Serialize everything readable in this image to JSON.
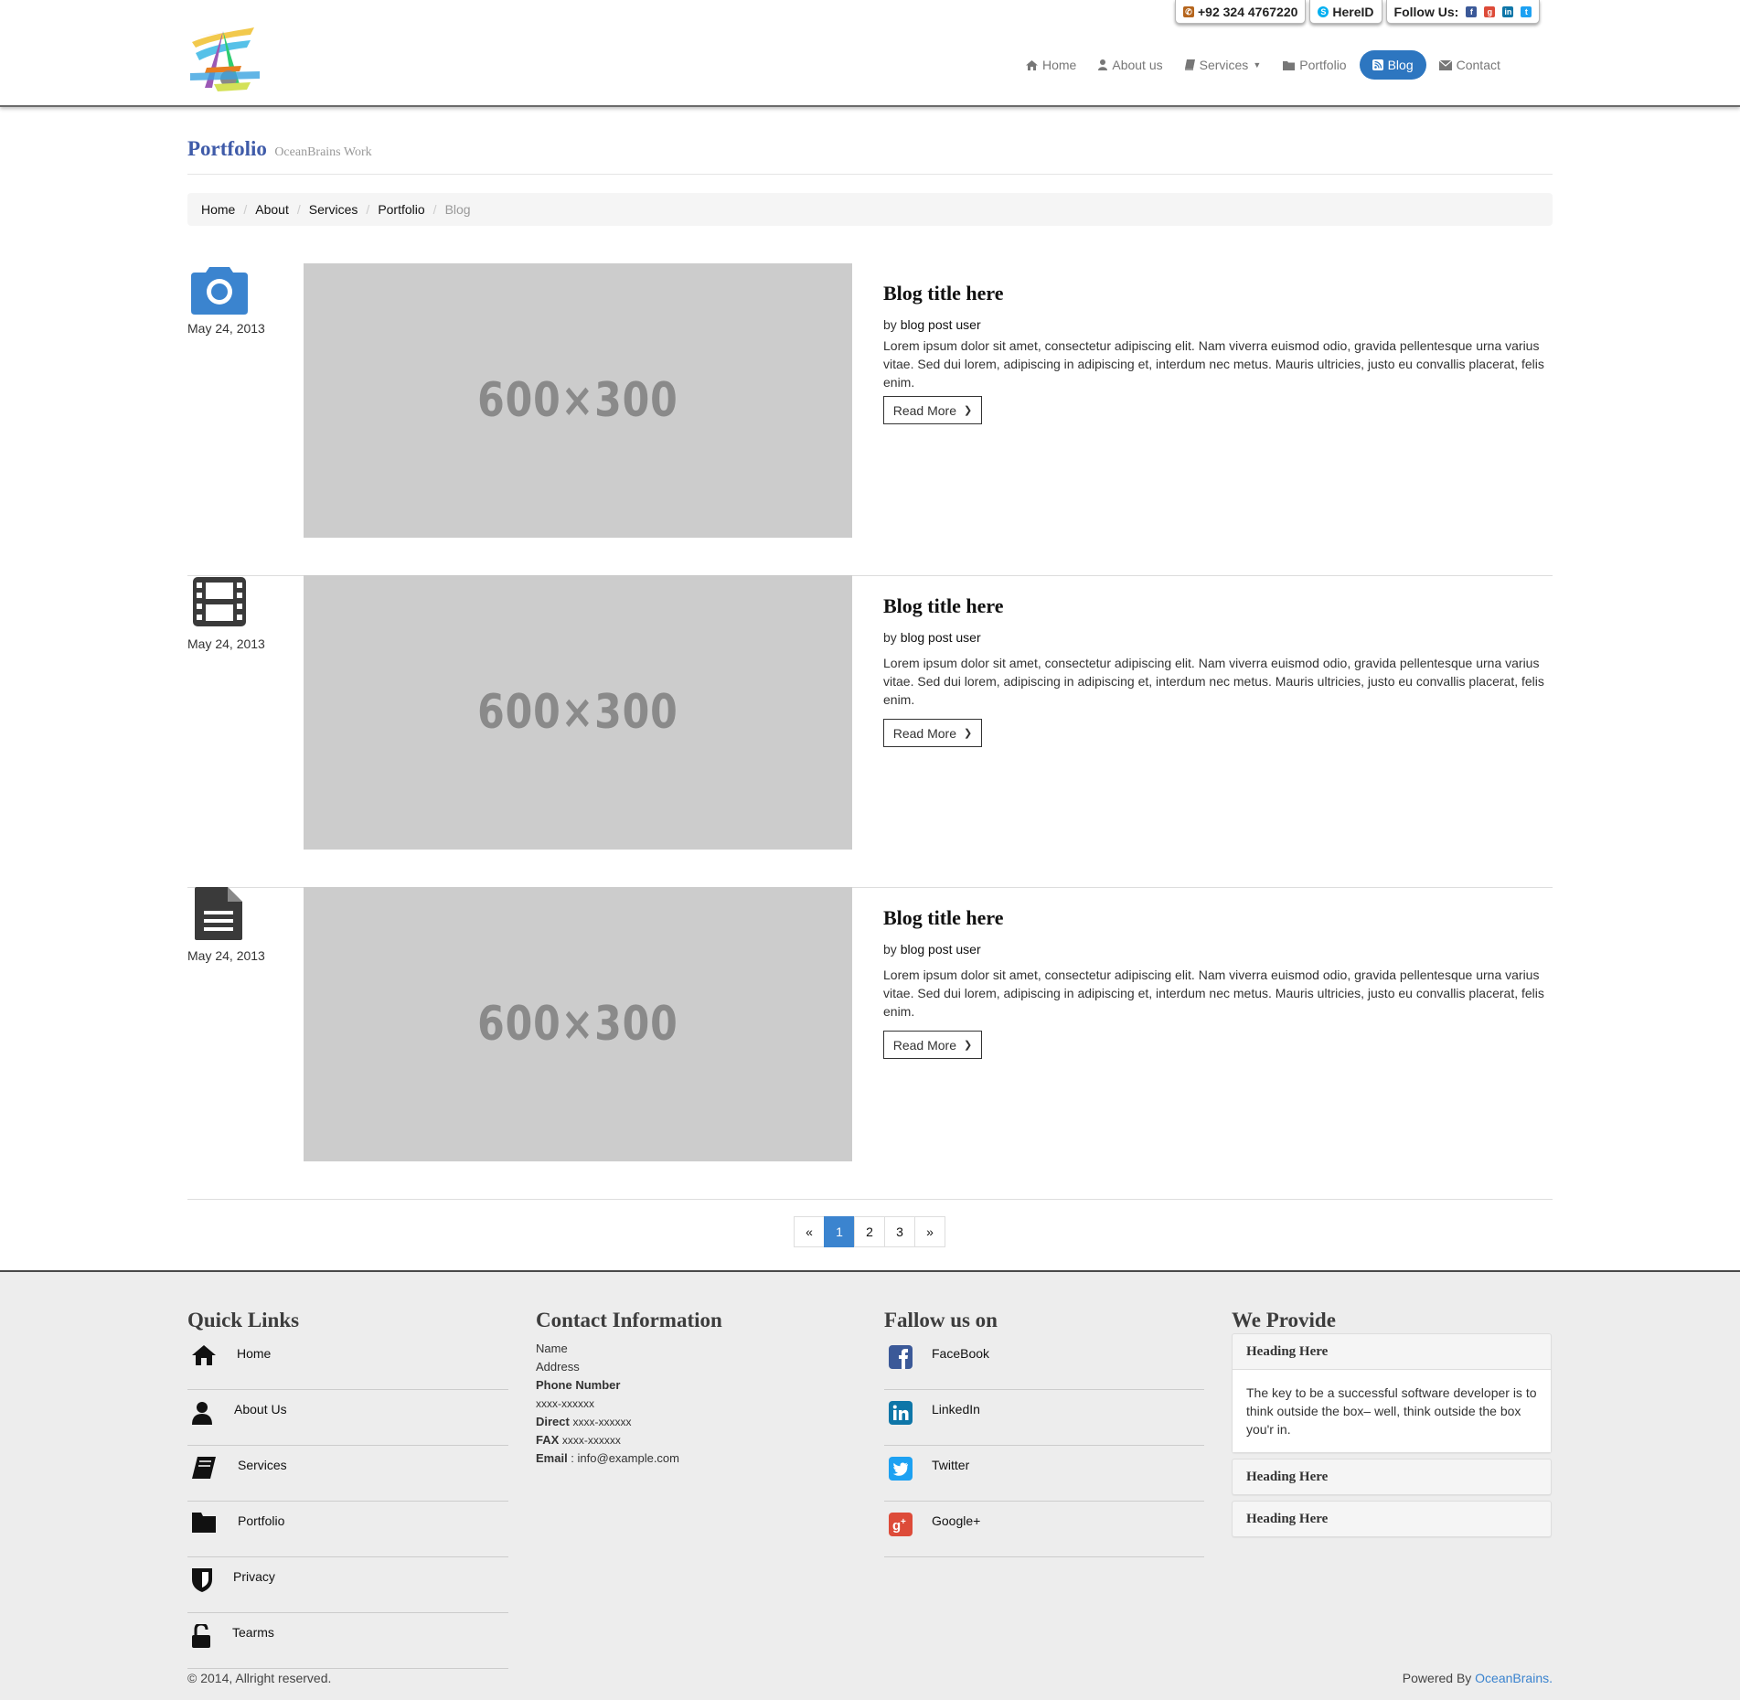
{
  "header": {
    "phone": "+92 324 4767220",
    "skype": "HereID",
    "follow_label": "Follow Us:",
    "nav": [
      {
        "label": "Home",
        "icon": "home-icon"
      },
      {
        "label": "About us",
        "icon": "user-icon"
      },
      {
        "label": "Services",
        "icon": "book-icon"
      },
      {
        "label": "Portfolio",
        "icon": "folder-icon"
      },
      {
        "label": "Blog",
        "icon": "rss-icon",
        "active": true
      },
      {
        "label": "Contact",
        "icon": "envelope-icon"
      }
    ]
  },
  "page": {
    "title": "Portfolio",
    "subtitle": "OceanBrains Work"
  },
  "breadcrumb": [
    "Home",
    "About",
    "Services",
    "Portfolio",
    "Blog"
  ],
  "posts": [
    {
      "icon": "camera-icon",
      "date": "May 24, 2013",
      "image_label": "600×300",
      "title": "Blog title here",
      "by": "by",
      "author": "blog post user",
      "text": "Lorem ipsum dolor sit amet, consectetur adipiscing elit. Nam viverra euismod odio, gravida pellentesque urna varius vitae. Sed dui lorem, adipiscing in adipiscing et, interdum nec metus. Mauris ultricies, justo eu convallis placerat, felis enim.",
      "button": "Read More"
    },
    {
      "icon": "film-icon",
      "date": "May 24, 2013",
      "image_label": "600×300",
      "title": "Blog title here",
      "by": "by",
      "author": "blog post user",
      "text": "Lorem ipsum dolor sit amet, consectetur adipiscing elit. Nam viverra euismod odio, gravida pellentesque urna varius vitae. Sed dui lorem, adipiscing in adipiscing et, interdum nec metus. Mauris ultricies, justo eu convallis placerat, felis enim.",
      "button": "Read More"
    },
    {
      "icon": "document-icon",
      "date": "May 24, 2013",
      "image_label": "600×300",
      "title": "Blog title here",
      "by": "by",
      "author": "blog post user",
      "text": "Lorem ipsum dolor sit amet, consectetur adipiscing elit. Nam viverra euismod odio, gravida pellentesque urna varius vitae. Sed dui lorem, adipiscing in adipiscing et, interdum nec metus. Mauris ultricies, justo eu convallis placerat, felis enim.",
      "button": "Read More"
    }
  ],
  "pagination": [
    "«",
    "1",
    "2",
    "3",
    "»"
  ],
  "pagination_active": "1",
  "footer": {
    "quick_links": {
      "title": "Quick Links",
      "items": [
        "Home",
        "About Us",
        "Services",
        "Portfolio",
        "Privacy",
        "Tearms"
      ]
    },
    "contact": {
      "title": "Contact Information",
      "name": "Name",
      "address": "Address",
      "phone_label": "Phone Number",
      "phone": "xxxx-xxxxxx",
      "direct_label": "Direct",
      "direct": "xxxx-xxxxxx",
      "fax_label": "FAX",
      "fax": "xxxx-xxxxxx",
      "email_label": "Email",
      "email": "info@example.com"
    },
    "follow": {
      "title": "Fallow us on",
      "items": [
        "FaceBook",
        "LinkedIn",
        "Twitter",
        "Google+"
      ]
    },
    "provide": {
      "title": "We Provide",
      "panels": [
        {
          "heading": "Heading Here",
          "body": "The key to be a successful software developer is to think outside the box– well, think outside the box you'r in."
        },
        {
          "heading": "Heading Here"
        },
        {
          "heading": "Heading Here"
        }
      ]
    },
    "copyright": "© 2014, Allright reserved.",
    "powered_prefix": "Powered By",
    "powered_link": "OceanBrains."
  },
  "colors": {
    "brand_blue": "#2d76c0",
    "title_blue": "#3f5ba9",
    "footer_bg": "#ededed",
    "placeholder_gray": "#cccccc",
    "facebook": "#3b5998",
    "linkedin": "#0e76a8",
    "twitter": "#1da1f2",
    "googleplus": "#dd4b39"
  }
}
